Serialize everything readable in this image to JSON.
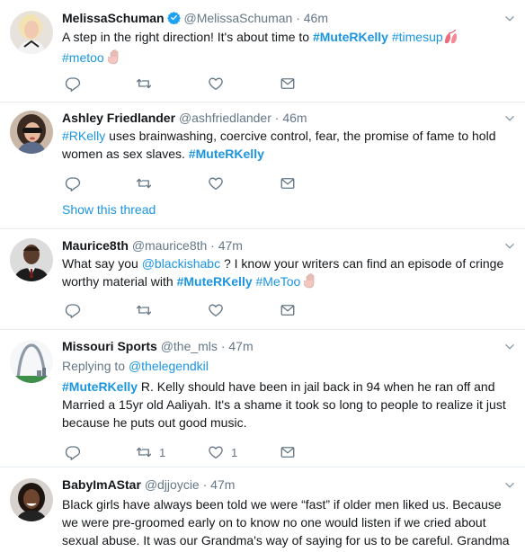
{
  "tweets": [
    {
      "name": "MelissaSchuman",
      "handle": "@MelissaSchuman",
      "dot": "·",
      "time": "46m",
      "verified": true,
      "text1": "A step in the right direction! It's about time to ",
      "tag1": "#MuteRKelly",
      "tag2": "#timesup",
      "tag3": "#metoo",
      "avatar_icon": "woman-blonde-avatar"
    },
    {
      "name": "Ashley Friedlander",
      "handle": "@ashfriedlander",
      "dot": "·",
      "time": "46m",
      "tag1": "#RKelly",
      "text1": " uses brainwashing, coercive control, fear, the promise of fame to hold women as sex slaves. ",
      "tag2": "#MuteRKelly",
      "show_thread": "Show this thread",
      "avatar_icon": "woman-sunglasses-avatar"
    },
    {
      "name": "Maurice8th",
      "handle": "@maurice8th",
      "dot": "·",
      "time": "47m",
      "text1": "What say you ",
      "mention1": "@blackishabc",
      "text2": " ? I know your writers can find an episode of cringe worthy material with ",
      "tag1": "#MuteRKelly",
      "tag2": "#MeToo",
      "avatar_icon": "man-suit-avatar"
    },
    {
      "name": "Missouri Sports",
      "handle": "@the_mls",
      "dot": "·",
      "time": "47m",
      "replying_label": "Replying to ",
      "replying_to": "@thelegendkil",
      "tag1": "#MuteRKelly",
      "text1": " R. Kelly should have been in jail back in 94 when he ran off and Married a 15yr old Aaliyah. It's a shame it took so long to people to realize it just because he puts out good music.",
      "retweets": "1",
      "likes": "1",
      "avatar_icon": "gateway-arch-avatar"
    },
    {
      "name": "BabyImAStar",
      "handle": "@djjoycie",
      "dot": "·",
      "time": "47m",
      "text1": "Black girls have always been told we were “fast” if older men liked us. Because we were pre-groomed early on to know no one would listen if we cried about sexual abuse. It was our Grandma's way of saying for us to be careful. Grandma knew no",
      "avatar_icon": "woman-smiling-avatar"
    }
  ],
  "colors": {
    "link": "#1b95e0",
    "muted": "#657786",
    "text": "#14171a",
    "border": "#e6ecf0"
  }
}
